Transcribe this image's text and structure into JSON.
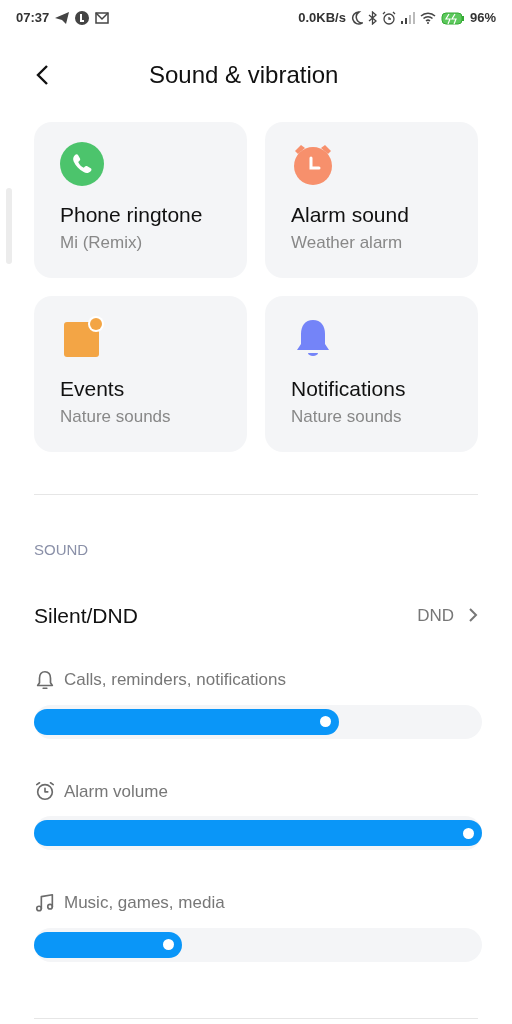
{
  "status_bar": {
    "time": "07:37",
    "speed": "0.0KB/s",
    "battery": "96%"
  },
  "header": {
    "title": "Sound & vibration"
  },
  "tiles": [
    {
      "kind": "phone",
      "title": "Phone ringtone",
      "subtitle": "Mi (Remix)"
    },
    {
      "kind": "alarm",
      "title": "Alarm sound",
      "subtitle": "Weather alarm"
    },
    {
      "kind": "events",
      "title": "Events",
      "subtitle": "Nature sounds"
    },
    {
      "kind": "bell",
      "title": "Notifications",
      "subtitle": "Nature sounds"
    }
  ],
  "section": {
    "heading": "SOUND"
  },
  "silent_row": {
    "label": "Silent/DND",
    "value": "DND"
  },
  "sliders": [
    {
      "kind": "bell",
      "label": "Calls, reminders, notifications",
      "level": 0.68
    },
    {
      "kind": "alarm",
      "label": "Alarm volume",
      "level": 1.0
    },
    {
      "kind": "music",
      "label": "Music, games, media",
      "level": 0.33
    }
  ]
}
